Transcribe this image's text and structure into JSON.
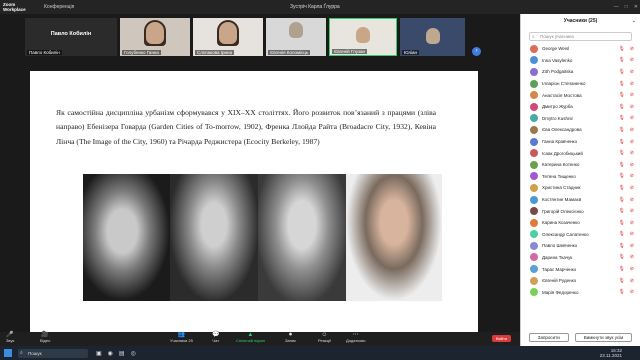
{
  "app": {
    "logo_line1": "Zoom",
    "logo_line2": "Workplace",
    "conference_tab": "Конференція",
    "meeting_title": "Зустріч Карла Ґлурра",
    "window_controls": [
      "—",
      "□",
      "✕"
    ]
  },
  "strip": {
    "first_tile_name": "Павло Кобилін",
    "first_tile_label": "Павло Кобилін",
    "tiles": [
      {
        "label": "Голубенко Ганна"
      },
      {
        "label": "Слєпакова Ірина"
      },
      {
        "label": "Євгенія Коломієць"
      },
      {
        "label": "Євгеній Глузан"
      },
      {
        "label": "Юліан"
      }
    ],
    "next_label": "›"
  },
  "slide": {
    "text": "Як самостійна дисципліна урбанізм сформувався у XIX–XX століттях. Його розвиток пов’язаний з працями (зліва направо) Ебенізера Говарда (Garden Cities of To-morrow, 1902), Френка Ллойда Райта (Broadacre City, 1932), Кевіна Лінча (The Image of the City, 1960) та Річарда Реджистера (Ecocity Berkeley, 1987)"
  },
  "toolbar": {
    "items": [
      {
        "icon": "🎤",
        "label": "Звук"
      },
      {
        "icon": "🎥",
        "label": "Відео"
      },
      {
        "icon": "👥",
        "label": "Учасники",
        "badge": "25"
      },
      {
        "icon": "💬",
        "label": "Чат"
      },
      {
        "icon": "▲",
        "label": "Спільний екран"
      },
      {
        "icon": "⏺",
        "label": "Запис"
      },
      {
        "icon": "☺",
        "label": "Реакції"
      },
      {
        "icon": "⋯",
        "label": "Додатково"
      }
    ],
    "end_label": "Вийти"
  },
  "panel": {
    "title": "Учасники (25)",
    "search_placeholder": "Пошук учасника",
    "participants": [
      {
        "name": "George Weisl",
        "color": "#e06a5a"
      },
      {
        "name": "Inna Vasylenko",
        "color": "#4a8fd8"
      },
      {
        "name": "Zöh Podgaitska",
        "color": "#8a6fd1"
      },
      {
        "name": "Ілларіон Степаненко",
        "color": "#5aa05a"
      },
      {
        "name": "Анастасія Мостова",
        "color": "#d0894a"
      },
      {
        "name": "Дмитро Журба",
        "color": "#d14a7a"
      },
      {
        "name": "Dmytro Kushnir",
        "color": "#4aa9a9"
      },
      {
        "name": "Єва Олександрова",
        "color": "#9a7a4a"
      },
      {
        "name": "Ганна Кравченко",
        "color": "#5a7ad1"
      },
      {
        "name": "Ісаак Дрогобицький",
        "color": "#c95a5a"
      },
      {
        "name": "Катерина Котенко",
        "color": "#6aa04a"
      },
      {
        "name": "Тетяна Тищенко",
        "color": "#a05ad1"
      },
      {
        "name": "Христина Стадник",
        "color": "#d1a04a"
      },
      {
        "name": "Костянтин Мамаєв",
        "color": "#4a9ad1"
      },
      {
        "name": "Григорій Олексієнко",
        "color": "#7a4a4a"
      },
      {
        "name": "Карина Козаченко",
        "color": "#e07a3a"
      },
      {
        "name": "Олександр Салатенко",
        "color": "#4ad1a0"
      },
      {
        "name": "Павло Шевченко",
        "color": "#8a8ad1"
      },
      {
        "name": "Дарина Ткачук",
        "color": "#d16aa0"
      },
      {
        "name": "Тарас Марченко",
        "color": "#5aa0d1"
      },
      {
        "name": "Євгеній Руденко",
        "color": "#d0a05a"
      },
      {
        "name": "Марія Федоренко",
        "color": "#7ad15a"
      }
    ],
    "invite_label": "Запросити",
    "mute_all_label": "Вимкнути звук усім"
  },
  "taskbar": {
    "search_placeholder": "Пошук",
    "time": "16:32",
    "date": "23.11.2021"
  }
}
